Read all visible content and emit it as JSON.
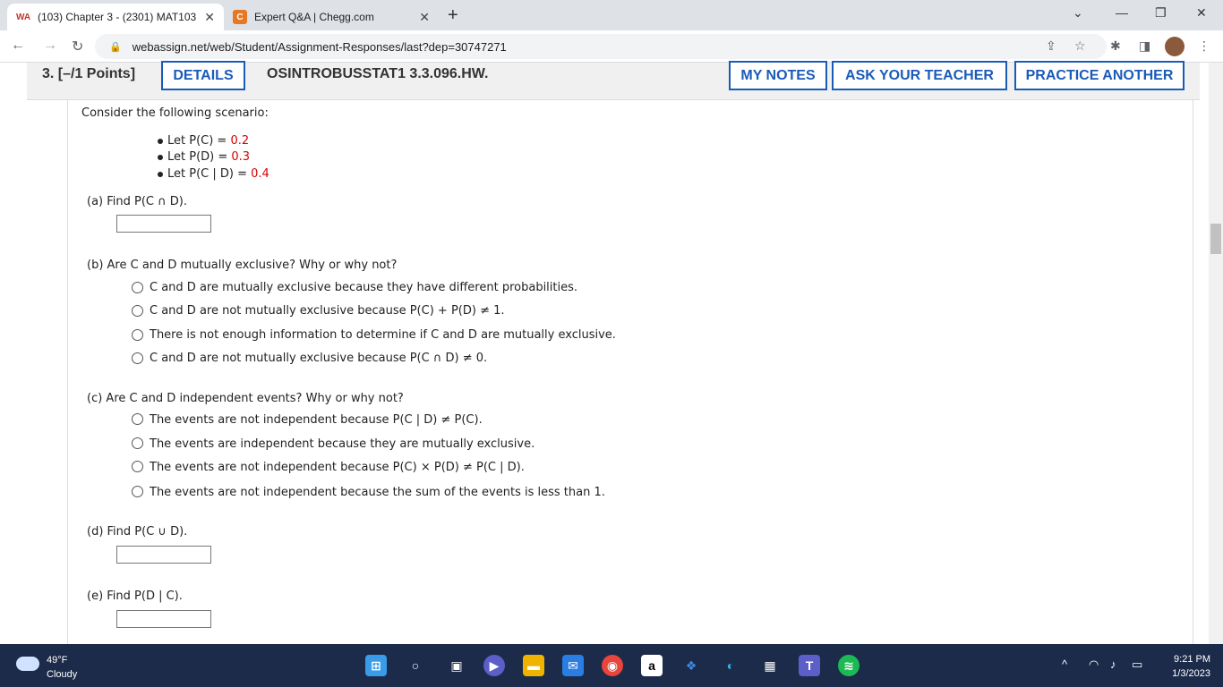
{
  "browser": {
    "tabs": [
      {
        "title": "(103) Chapter 3 - (2301) MAT103",
        "favicon": "WA"
      },
      {
        "title": "Expert Q&A | Chegg.com",
        "favicon": "C"
      }
    ],
    "url": "webassign.net/web/Student/Assignment-Responses/last?dep=30747271"
  },
  "question": {
    "number": "3. [–/1 Points]",
    "details_label": "DETAILS",
    "code": "OSINTROBUSSTAT1 3.3.096.HW.",
    "my_notes_label": "MY NOTES",
    "ask_teacher_label": "ASK YOUR TEACHER",
    "practice_label": "PRACTICE ANOTHER"
  },
  "scenario": {
    "intro": "Consider the following scenario:",
    "items": [
      {
        "label": "Let P(C) = ",
        "value": "0.2"
      },
      {
        "label": "Let P(D) = ",
        "value": "0.3"
      },
      {
        "label": "Let P(C | D) = ",
        "value": "0.4"
      }
    ]
  },
  "parts": {
    "a": {
      "prompt": "(a)   Find P(C ∩ D).",
      "value": ""
    },
    "b": {
      "prompt": "(b)   Are C and D mutually exclusive? Why or why not?",
      "options": [
        "C and D are mutually exclusive because they have different probabilities.",
        "C and D are not mutually exclusive because P(C) + P(D) ≠ 1.",
        "There is not enough information to determine if C and D are mutually exclusive.",
        "C and D are not mutually exclusive because P(C ∩ D) ≠ 0."
      ]
    },
    "c": {
      "prompt": "(c)   Are C and D independent events? Why or why not?",
      "options": [
        "The events are not independent because P(C | D) ≠ P(C).",
        "The events are independent because they are mutually exclusive.",
        "The events are not independent because P(C) × P(D) ≠ P(C | D).",
        "The events are not independent because the sum of the events is less than 1."
      ]
    },
    "d": {
      "prompt": "(d)   Find P(C ∪ D).",
      "value": ""
    },
    "e": {
      "prompt": "(e)   Find P(D | C).",
      "value": ""
    }
  },
  "taskbar": {
    "temperature": "49°F",
    "condition": "Cloudy",
    "time": "9:21 PM",
    "date": "1/3/2023"
  }
}
